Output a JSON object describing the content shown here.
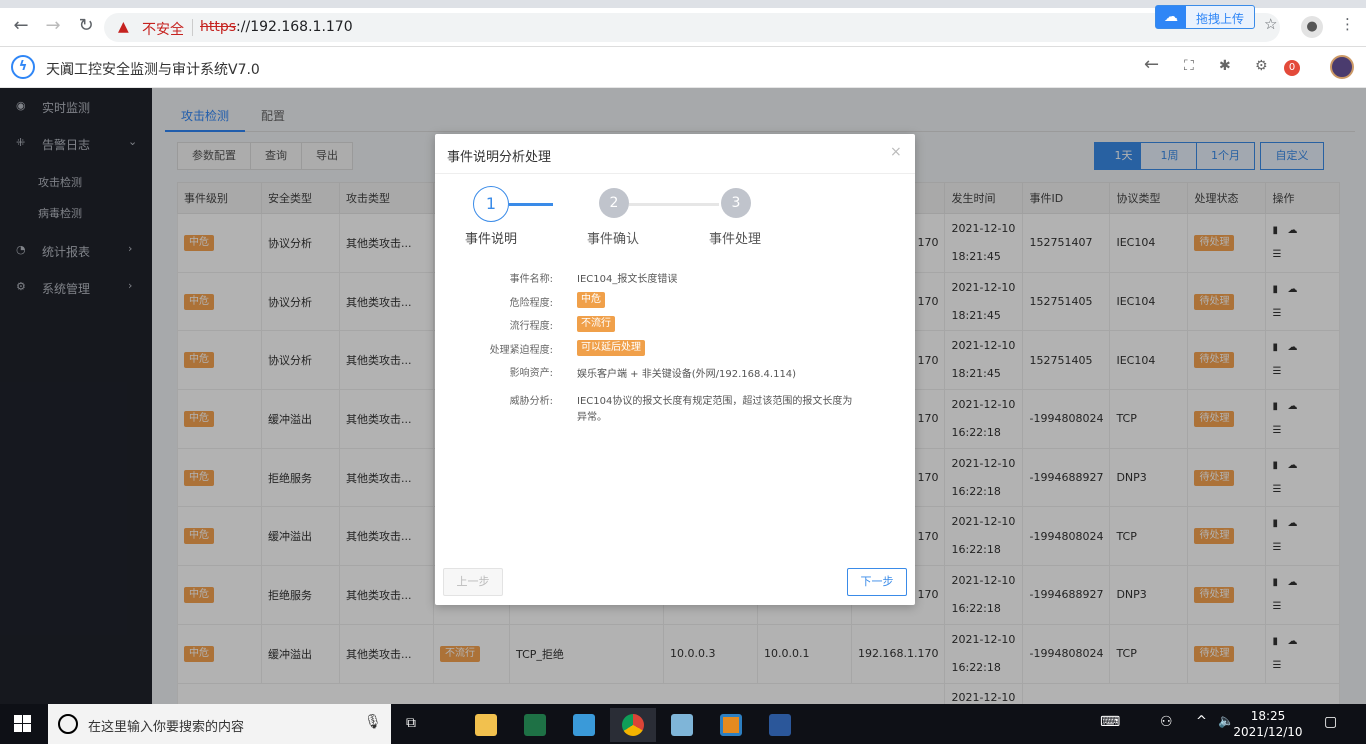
{
  "browser": {
    "insecure_label": "不安全",
    "url_scheme": "https",
    "url_rest": "://192.168.1.170",
    "upload_label": "拖拽上传"
  },
  "app": {
    "title": "天阗工控安全监测与审计系统V7.0",
    "notification_count": "0"
  },
  "sidebar": {
    "items": [
      {
        "label": "实时监测"
      },
      {
        "label": "告警日志"
      },
      {
        "label": "统计报表"
      },
      {
        "label": "系统管理"
      }
    ],
    "subitems": [
      {
        "label": "攻击检测"
      },
      {
        "label": "病毒检测"
      }
    ]
  },
  "tabs": [
    {
      "label": "攻击检测"
    },
    {
      "label": "配置"
    }
  ],
  "toolbar": {
    "buttons": [
      "参数配置",
      "查询",
      "导出"
    ],
    "ranges": [
      "1天",
      "1周",
      "1个月",
      "自定义"
    ]
  },
  "table": {
    "headers": [
      "事件级别",
      "安全类型",
      "攻击类型",
      "",
      "",
      "",
      "",
      "",
      "发生时间",
      "事件ID",
      "协议类型",
      "处理状态",
      "操作"
    ],
    "rows": [
      {
        "level": "中危",
        "sec": "协议分析",
        "atk": "其他类攻击...",
        "pop": "",
        "name": "",
        "src": "",
        "dst": "",
        "dev": "170",
        "date": "2021-12-10",
        "time": "18:21:45",
        "id": "152751407",
        "proto": "IEC104",
        "status": "待处理"
      },
      {
        "level": "中危",
        "sec": "协议分析",
        "atk": "其他类攻击...",
        "pop": "",
        "name": "",
        "src": "",
        "dst": "",
        "dev": "170",
        "date": "2021-12-10",
        "time": "18:21:45",
        "id": "152751405",
        "proto": "IEC104",
        "status": "待处理"
      },
      {
        "level": "中危",
        "sec": "协议分析",
        "atk": "其他类攻击...",
        "pop": "",
        "name": "",
        "src": "",
        "dst": "",
        "dev": "170",
        "date": "2021-12-10",
        "time": "18:21:45",
        "id": "152751405",
        "proto": "IEC104",
        "status": "待处理"
      },
      {
        "level": "中危",
        "sec": "缓冲溢出",
        "atk": "其他类攻击...",
        "pop": "",
        "name": "",
        "src": "",
        "dst": "",
        "dev": "170",
        "date": "2021-12-10",
        "time": "16:22:18",
        "id": "-1994808024",
        "proto": "TCP",
        "status": "待处理"
      },
      {
        "level": "中危",
        "sec": "拒绝服务",
        "atk": "其他类攻击...",
        "pop": "",
        "name": "",
        "src": "",
        "dst": "",
        "dev": "170",
        "date": "2021-12-10",
        "time": "16:22:18",
        "id": "-1994688927",
        "proto": "DNP3",
        "status": "待处理"
      },
      {
        "level": "中危",
        "sec": "缓冲溢出",
        "atk": "其他类攻击...",
        "pop": "",
        "name": "",
        "src": "",
        "dst": "",
        "dev": "170",
        "date": "2021-12-10",
        "time": "16:22:18",
        "id": "-1994808024",
        "proto": "TCP",
        "status": "待处理"
      },
      {
        "level": "中危",
        "sec": "拒绝服务",
        "atk": "其他类攻击...",
        "pop": "",
        "name": "",
        "src": "",
        "dst": "",
        "dev": "170",
        "date": "2021-12-10",
        "time": "16:22:18",
        "id": "-1994688927",
        "proto": "DNP3",
        "status": "待处理"
      },
      {
        "level": "中危",
        "sec": "缓冲溢出",
        "atk": "其他类攻击...",
        "pop": "不流行",
        "name": "TCP_拒绝",
        "src": "10.0.0.3",
        "dst": "10.0.0.1",
        "dev": "192.168.1.170",
        "date": "2021-12-10",
        "time": "16:22:18",
        "id": "-1994808024",
        "proto": "TCP",
        "status": "待处理"
      }
    ],
    "partial_row_date": "2021-12-10"
  },
  "modal": {
    "title": "事件说明分析处理",
    "steps": [
      {
        "num": "1",
        "label": "事件说明"
      },
      {
        "num": "2",
        "label": "事件确认"
      },
      {
        "num": "3",
        "label": "事件处理"
      }
    ],
    "fields": {
      "name_label": "事件名称:",
      "name_value": "IEC104_报文长度错误",
      "danger_label": "危险程度:",
      "danger_value": "中危",
      "popularity_label": "流行程度:",
      "popularity_value": "不流行",
      "urgency_label": "处理紧迫程度:",
      "urgency_value": "可以延后处理",
      "asset_label": "影响资产:",
      "asset_value": "娱乐客户端 + 非关键设备(外网/192.168.4.114)",
      "threat_label": "威胁分析:",
      "threat_value_line1": "IEC104协议的报文长度有规定范围，超过该范围的报文长度为",
      "threat_value_line2": "异常。"
    },
    "prev_label": "上一步",
    "next_label": "下一步"
  },
  "taskbar": {
    "search_placeholder": "在这里输入你要搜索的内容",
    "time": "18:25",
    "date": "2021/12/10"
  },
  "colors": {
    "accent": "#3a8be8",
    "tag_orange": "#f7a451",
    "sidebar_bg": "#20232c"
  }
}
